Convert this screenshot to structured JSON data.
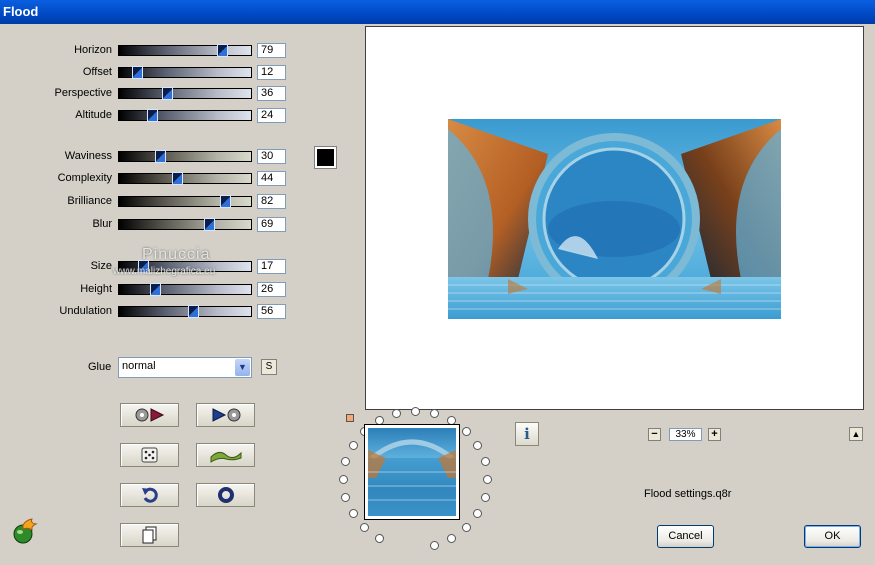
{
  "window": {
    "title": "Flood"
  },
  "sliders": [
    {
      "label": "Horizon",
      "value": "79",
      "level": 79
    },
    {
      "label": "Offset",
      "value": "12",
      "level": 12
    },
    {
      "label": "Perspective",
      "value": "36",
      "level": 36
    },
    {
      "label": "Altitude",
      "value": "24",
      "level": 24
    },
    {
      "label": "Waviness",
      "value": "30",
      "level": 30
    },
    {
      "label": "Complexity",
      "value": "44",
      "level": 44
    },
    {
      "label": "Brilliance",
      "value": "82",
      "level": 82
    },
    {
      "label": "Blur",
      "value": "69",
      "level": 69
    },
    {
      "label": "Size",
      "value": "17",
      "level": 17
    },
    {
      "label": "Height",
      "value": "26",
      "level": 26
    },
    {
      "label": "Undulation",
      "value": "56",
      "level": 56
    }
  ],
  "color_swatch": "#000000",
  "glue": {
    "label": "Glue",
    "value": "normal",
    "random_label": "S"
  },
  "watermark": {
    "name": "Pinuccia",
    "site": "www.malizhegrafica.eu"
  },
  "zoom": {
    "minus": "−",
    "value": "33%",
    "plus": "+"
  },
  "preset": {
    "filename": "Flood settings.q8r"
  },
  "buttons": {
    "cancel": "Cancel",
    "ok": "OK",
    "info": "i",
    "scroll_up": "▲"
  },
  "icons": {
    "tool_1": "record-rewind-icon",
    "tool_2": "play-record-icon",
    "tool_3": "dice-icon",
    "tool_4": "wave-icon",
    "tool_5": "undo-icon",
    "tool_6": "reset-ring-icon",
    "tool_7": "copy-page-icon",
    "logo": "flaming-globe-icon"
  }
}
